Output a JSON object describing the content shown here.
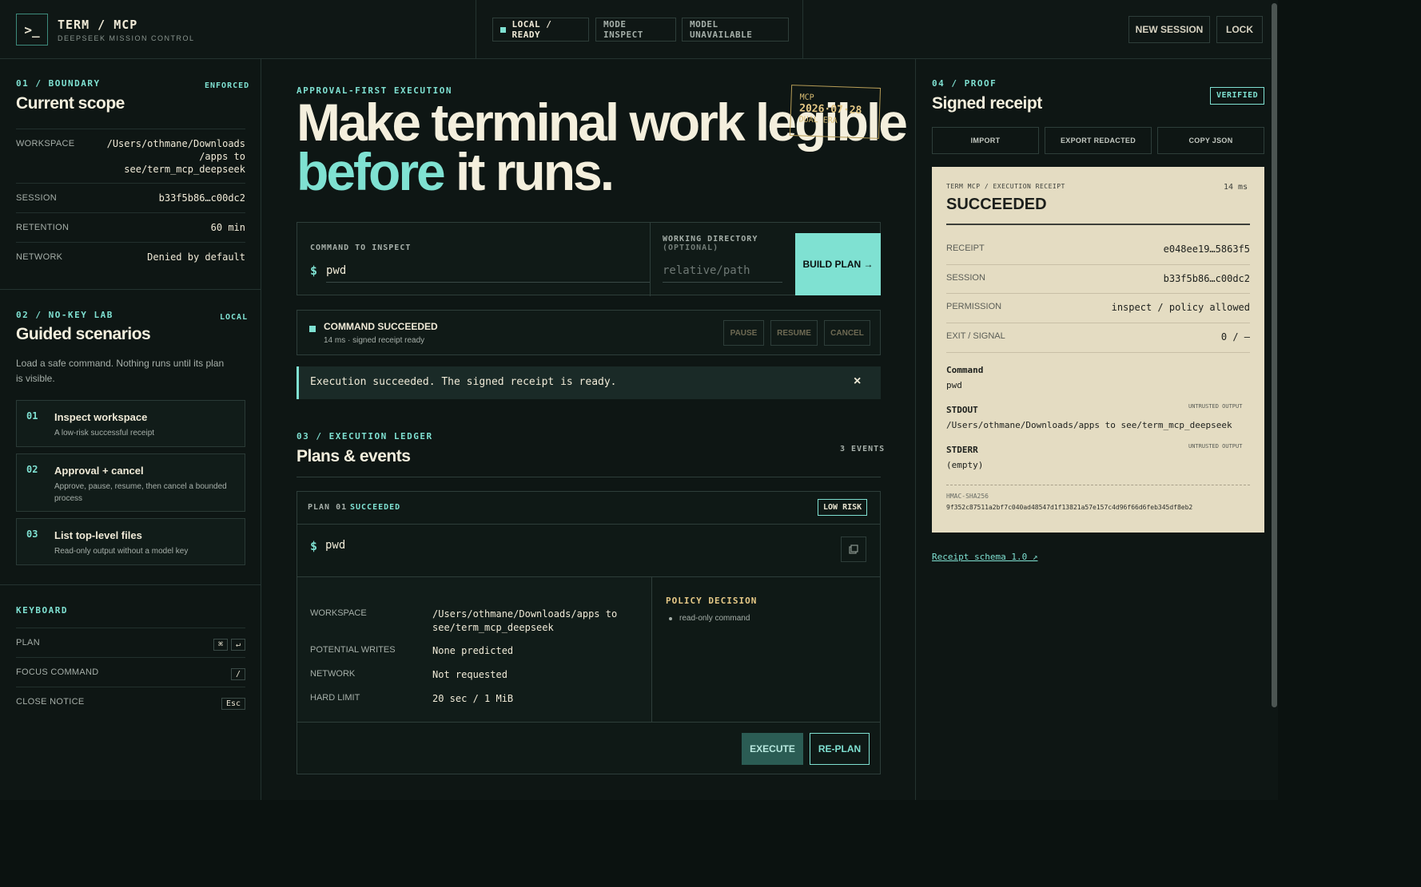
{
  "app": {
    "logo": ">_",
    "title": "TERM / MCP",
    "subtitle": "DEEPSEEK MISSION CONTROL"
  },
  "status": {
    "ready": "LOCAL / READY",
    "mode": "MODE INSPECT",
    "model": "MODEL UNAVAILABLE"
  },
  "top_actions": {
    "new_session": "NEW SESSION",
    "lock": "LOCK"
  },
  "boundary": {
    "label": "01 / BOUNDARY",
    "badge": "ENFORCED",
    "title": "Current scope",
    "rows": [
      {
        "k": "WORKSPACE",
        "v1": "/Users/othmane/Downloads",
        "v2": "/apps to",
        "v3": "see/term_mcp_deepseek"
      },
      {
        "k": "SESSION",
        "v": "b33f5b86…c00dc2"
      },
      {
        "k": "RETENTION",
        "v": "60 min"
      },
      {
        "k": "NETWORK",
        "v": "Denied by default"
      }
    ]
  },
  "lab": {
    "label": "02 / NO-KEY LAB",
    "badge": "LOCAL",
    "title": "Guided scenarios",
    "desc": "Load a safe command. Nothing runs until its plan is visible.",
    "items": [
      {
        "num": "01",
        "title": "Inspect workspace",
        "desc": "A low-risk successful receipt"
      },
      {
        "num": "02",
        "title": "Approval + cancel",
        "desc": "Approve, pause, resume, then cancel a bounded process"
      },
      {
        "num": "03",
        "title": "List top-level files",
        "desc": "Read-only output without a model key"
      }
    ]
  },
  "keyboard": {
    "label": "KEYBOARD",
    "rows": [
      {
        "k": "PLAN",
        "keys": [
          "⌘",
          "↵"
        ]
      },
      {
        "k": "FOCUS COMMAND",
        "keys": [
          "/"
        ]
      },
      {
        "k": "CLOSE NOTICE",
        "keys": [
          "Esc"
        ]
      }
    ]
  },
  "hero": {
    "kicker": "APPROVAL-FIRST EXECUTION",
    "line1": "Make terminal work legible",
    "accent": "before",
    "rest": " it runs."
  },
  "stamp": {
    "l1": "MCP",
    "date": "2026·07·28",
    "l3": "DUAL ERA"
  },
  "command": {
    "label": "COMMAND TO INSPECT",
    "prompt": "$",
    "value": "pwd",
    "wd_label1": "WORKING DIRECTORY",
    "wd_label2": "(OPTIONAL)",
    "wd_placeholder": "relative/path",
    "build": "BUILD PLAN →"
  },
  "run_status": {
    "title": "COMMAND SUCCEEDED",
    "meta": "14 ms · signed receipt ready",
    "pause": "PAUSE",
    "resume": "RESUME",
    "cancel": "CANCEL"
  },
  "notice": {
    "text": "Execution succeeded. The signed receipt is ready.",
    "close": "×"
  },
  "ledger": {
    "label": "03 / EXECUTION LEDGER",
    "title": "Plans & events",
    "count": "3 EVENTS",
    "plan": {
      "id": "PLAN 01",
      "state": "SUCCEEDED",
      "risk": "LOW RISK",
      "prompt": "$",
      "cmd": "pwd",
      "rows": [
        {
          "k": "WORKSPACE",
          "v1": "/Users/othmane/Downloads/apps to",
          "v2": "see/term_mcp_deepseek"
        },
        {
          "k": "POTENTIAL WRITES",
          "v": "None predicted"
        },
        {
          "k": "NETWORK",
          "v": "Not requested"
        },
        {
          "k": "HARD LIMIT",
          "v": "20 sec / 1 MiB"
        }
      ],
      "policy_title": "POLICY DECISION",
      "policy_item": "read-only command",
      "execute": "EXECUTE",
      "replan": "RE-PLAN"
    }
  },
  "proof": {
    "label": "04 / PROOF",
    "badge": "VERIFIED",
    "title": "Signed receipt",
    "import": "IMPORT",
    "export": "EXPORT REDACTED",
    "copy": "COPY JSON",
    "receipt": {
      "header": "TERM MCP / EXECUTION RECEIPT",
      "ms": "14 ms",
      "status": "SUCCEEDED",
      "rows": [
        {
          "k": "RECEIPT",
          "v": "e048ee19…5863f5"
        },
        {
          "k": "SESSION",
          "v": "b33f5b86…c00dc2"
        },
        {
          "k": "PERMISSION",
          "v": "inspect / policy allowed"
        },
        {
          "k": "EXIT / SIGNAL",
          "v": "0 / —"
        }
      ],
      "command_label": "Command",
      "command": "pwd",
      "stdout_label": "STDOUT",
      "stdout_tag": "UNTRUSTED OUTPUT",
      "stdout": "/Users/othmane/Downloads/apps to see/term_mcp_deepseek",
      "stderr_label": "STDERR",
      "stderr_tag": "UNTRUSTED OUTPUT",
      "stderr": "(empty)",
      "hmac_label": "HMAC-SHA256",
      "hmac": "9f352c87511a2bf7c040ad48547d1f13821a57e157c4d96f66d6feb345df8eb2"
    },
    "schema_link": "Receipt schema 1.0 ↗"
  },
  "colors": {
    "accent": "#7fe1d2",
    "bg": "#0b1210",
    "paper": "#e4dcc2",
    "gold": "#d9bd73"
  }
}
